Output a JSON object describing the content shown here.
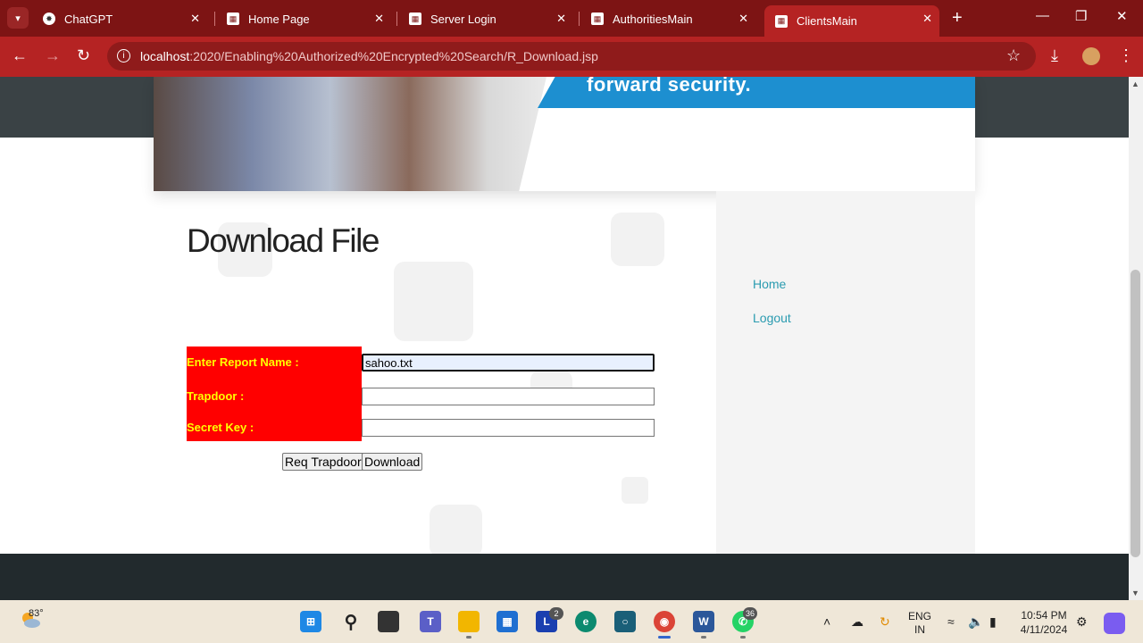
{
  "browser": {
    "tabs": [
      {
        "title": "ChatGPT",
        "active": false
      },
      {
        "title": "Home Page",
        "active": false
      },
      {
        "title": "Server Login",
        "active": false
      },
      {
        "title": "AuthoritiesMain",
        "active": false
      },
      {
        "title": "ClientsMain",
        "active": true
      }
    ],
    "url_host": "localhost",
    "url_path": ":2020/Enabling%20Authorized%20Encrypted%20Search/R_Download.jsp"
  },
  "banner": {
    "text": "forward security."
  },
  "page": {
    "heading": "Download File",
    "form": {
      "report_label": "Enter Report Name :",
      "report_value": "sahoo.txt",
      "trapdoor_label": "Trapdoor :",
      "trapdoor_value": "",
      "secret_label": "Secret Key :",
      "secret_value": "",
      "req_trapdoor_button": "Req Trapdoor",
      "download_button": "Download"
    },
    "sidebar": {
      "links": [
        {
          "label": "Home"
        },
        {
          "label": "Logout"
        }
      ]
    }
  },
  "taskbar": {
    "weather_temp": "83°",
    "apps": [
      {
        "name": "start",
        "icon": "windows-icon"
      },
      {
        "name": "search",
        "icon": "search-icon"
      },
      {
        "name": "task-view",
        "icon": "task-view-icon"
      },
      {
        "name": "teams",
        "icon": "teams-icon"
      },
      {
        "name": "file-explorer",
        "icon": "folder-icon"
      },
      {
        "name": "store",
        "icon": "store-icon"
      },
      {
        "name": "l-app",
        "icon": "l-app-icon",
        "badge": "2"
      },
      {
        "name": "edge",
        "icon": "edge-icon"
      },
      {
        "name": "cortana",
        "icon": "circle-app-icon"
      },
      {
        "name": "chrome",
        "icon": "chrome-icon"
      },
      {
        "name": "word",
        "icon": "word-icon"
      },
      {
        "name": "whatsapp",
        "icon": "whatsapp-icon",
        "badge": "36"
      }
    ],
    "language_line1": "ENG",
    "language_line2": "IN",
    "time": "10:54 PM",
    "date": "4/11/2024"
  },
  "colors": {
    "browser_frame": "#b52323",
    "tab_strip": "#7d1414",
    "form_label_bg": "#ff0000",
    "form_label_text": "#ffff00",
    "link": "#2a9bb0",
    "banner_blue": "#1d8fd0"
  }
}
